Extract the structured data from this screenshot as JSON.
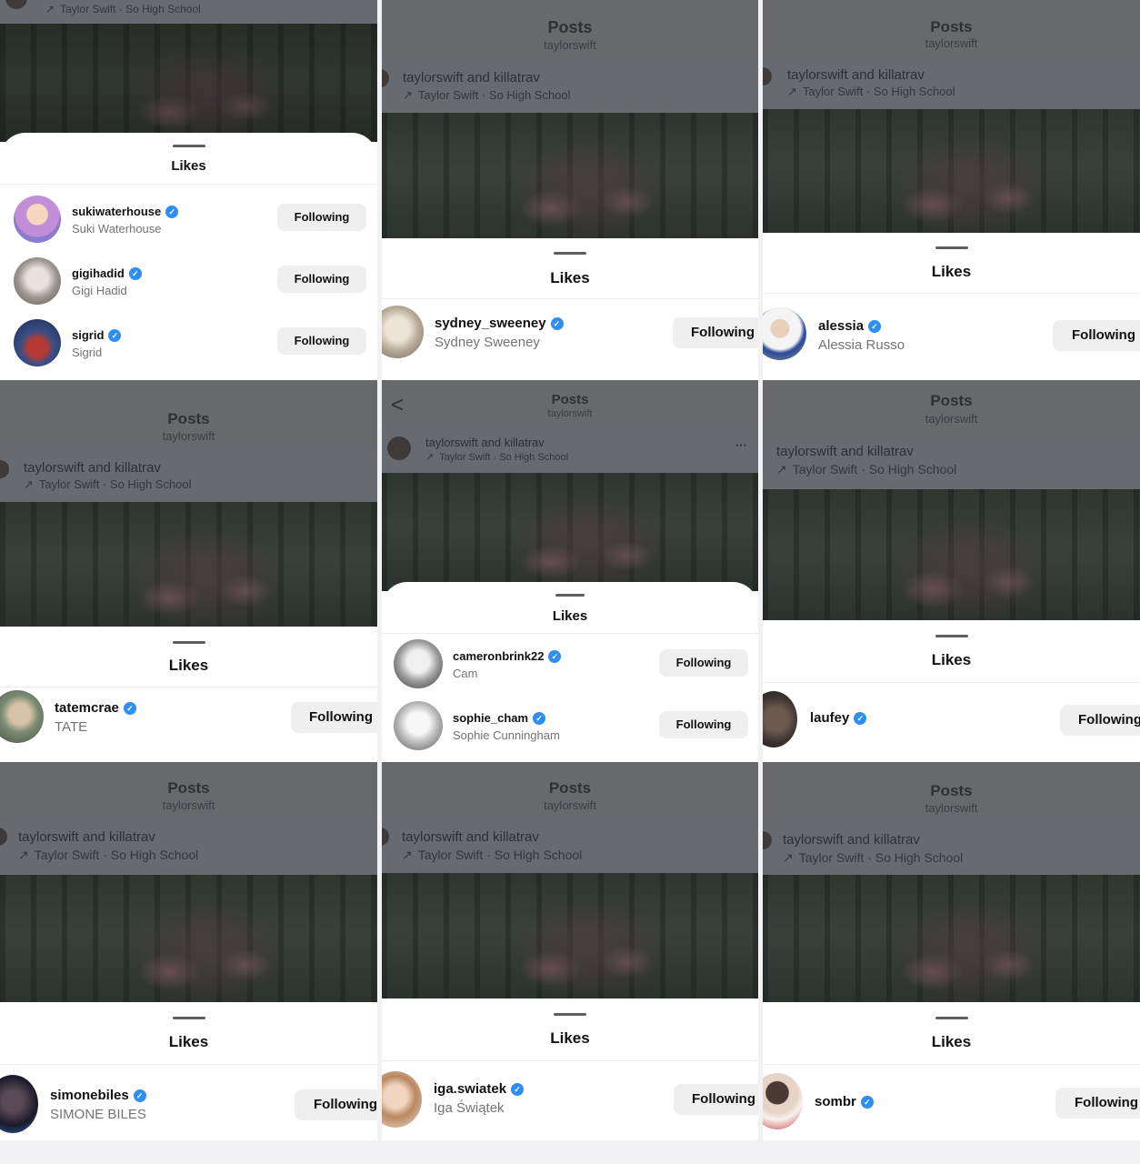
{
  "post": {
    "header_title": "Posts",
    "header_subtitle": "taylorswift",
    "authors": "taylorswift and killatrav",
    "audio": "Taylor Swift · So High School",
    "more_label": "···",
    "back_label": "<"
  },
  "sheet": {
    "title": "Likes"
  },
  "colors": {
    "verified": "#2f8ef4",
    "following_bg": "#efefef",
    "dim_overlay": "#6b6d71"
  },
  "panels": [
    {
      "id": "p1",
      "likers": [
        {
          "username": "sukiwaterhouse",
          "fullname": "Suki Waterhouse",
          "button": "Following"
        },
        {
          "username": "gigihadid",
          "fullname": "Gigi Hadid",
          "button": "Following"
        },
        {
          "username": "sigrid",
          "fullname": "Sigrid",
          "button": "Following"
        }
      ]
    },
    {
      "id": "p2",
      "likers": [
        {
          "username": "sydney_sweeney",
          "fullname": "Sydney Sweeney",
          "button": "Following"
        }
      ]
    },
    {
      "id": "p3",
      "likers": [
        {
          "username": "alessia",
          "fullname": "Alessia Russo",
          "button": "Following"
        }
      ]
    },
    {
      "id": "p4",
      "likers": [
        {
          "username": "tatemcrae",
          "fullname": "TATE",
          "button": "Following"
        }
      ]
    },
    {
      "id": "p5",
      "likers": [
        {
          "username": "cameronbrink22",
          "fullname": "Cam",
          "button": "Following"
        },
        {
          "username": "sophie_cham",
          "fullname": "Sophie Cunningham",
          "button": "Following"
        }
      ]
    },
    {
      "id": "p6",
      "likers": [
        {
          "username": "laufey",
          "fullname": "",
          "button": "Following"
        }
      ]
    },
    {
      "id": "p7",
      "likers": [
        {
          "username": "simonebiles",
          "fullname": "SIMONE BILES",
          "button": "Following"
        }
      ]
    },
    {
      "id": "p8",
      "likers": [
        {
          "username": "iga.swiatek",
          "fullname": "Iga Świątek",
          "button": "Following"
        }
      ]
    },
    {
      "id": "p9",
      "likers": [
        {
          "username": "sombr",
          "fullname": "",
          "button": "Following"
        }
      ]
    }
  ]
}
